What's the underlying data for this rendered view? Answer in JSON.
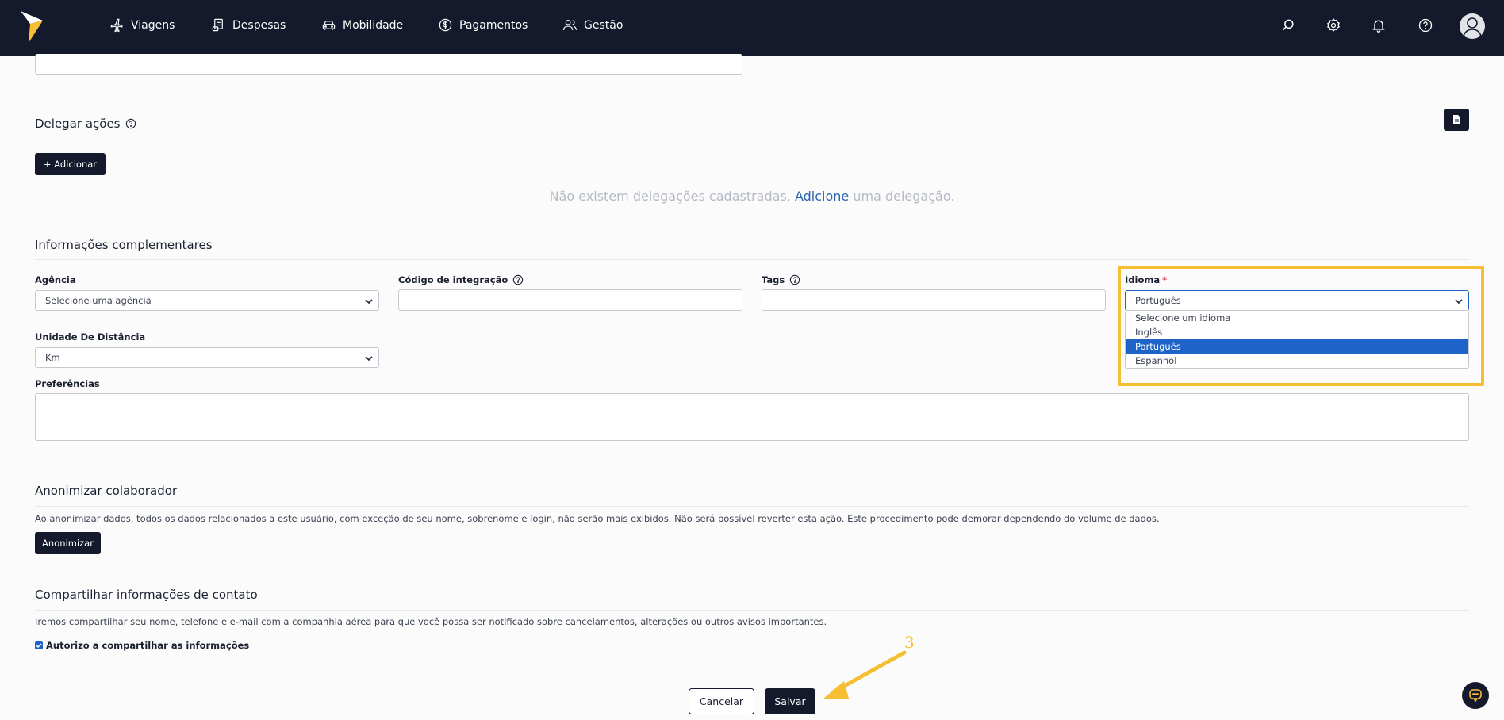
{
  "nav": {
    "items": [
      {
        "label": "Viagens",
        "icon": "airplane-icon"
      },
      {
        "label": "Despesas",
        "icon": "receipt-icon"
      },
      {
        "label": "Mobilidade",
        "icon": "car-icon"
      },
      {
        "label": "Pagamentos",
        "icon": "dollar-icon"
      },
      {
        "label": "Gestão",
        "icon": "users-icon"
      }
    ]
  },
  "delegate": {
    "title": "Delegar ações",
    "add_label": "+ Adicionar",
    "empty_before": "Não existem delegações cadastradas,",
    "empty_link": "Adicione",
    "empty_after": "uma delegação."
  },
  "complementary": {
    "title": "Informações complementares",
    "agency_label": "Agência",
    "agency_value": "Selecione uma agência",
    "integration_label": "Código de integração",
    "tags_label": "Tags",
    "language_label": "Idioma",
    "language_required": "*",
    "language_value": "Português",
    "language_options": [
      "Selecione um idioma",
      "Inglês",
      "Português",
      "Espanhol"
    ],
    "distance_label": "Unidade De Distância",
    "distance_value": "Km",
    "preferences_label": "Preferências"
  },
  "anonymize": {
    "title": "Anonimizar colaborador",
    "description": "Ao anonimizar dados, todos os dados relacionados a este usuário, com exceção de seu nome, sobrenome e login, não serão mais exibidos. Não será possível reverter esta ação. Este procedimento pode demorar dependendo do volume de dados.",
    "button_label": "Anonimizar"
  },
  "share": {
    "title": "Compartilhar informações de contato",
    "description": "Iremos compartilhar seu nome, telefone e e-mail com a companhia aérea para que você possa ser notificado sobre cancelamentos, alterações ou outros avisos importantes.",
    "checkbox_label": "Autorizo a compartilhar as informações",
    "checked": true
  },
  "footer": {
    "cancel_label": "Cancelar",
    "save_label": "Salvar"
  },
  "annotation": {
    "step_number": "3",
    "color": "#f6bf33"
  },
  "colors": {
    "navbar": "#14192b",
    "selected_option": "#1d63c8",
    "link": "#2c64b0",
    "highlight": "#f6bf33"
  }
}
